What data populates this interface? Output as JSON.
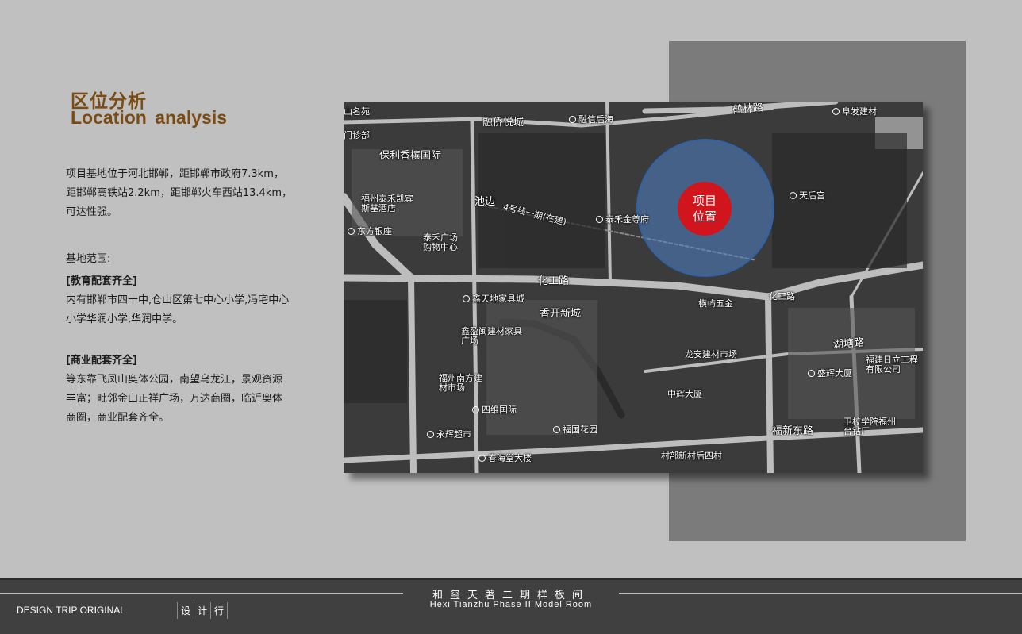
{
  "header": {
    "title_cn": "区位分析",
    "title_en": "Location  analysis"
  },
  "body": {
    "intro": "项目基地位于河北邯郸，距邯郸市政府7.3km，距邯郸高铁站2.2km，距邯郸火车西站13.4km，可达性强。",
    "scope_label": "基地范围:",
    "education_heading": "[教育配套齐全]",
    "education_text": "内有邯郸市四十中,仓山区第七中心小学,冯宅中心小学华润小学,华润中学。",
    "commerce_heading": "[商业配套齐全]",
    "commerce_text": "等东靠飞凤山奥体公园，南望乌龙江，景观资源丰富；毗邻金山正祥广场，万达商圈，临近奥体商圈，商业配套齐全。"
  },
  "map": {
    "site_marker": {
      "line1": "项目",
      "line2": "位置"
    },
    "colors": {
      "site_circle": "#5082c8",
      "site_marker": "#d0161c"
    },
    "labels": [
      "山名苑",
      "融侨悦城",
      "融信后海",
      "鹤林路",
      "阜发建材",
      "门诊部",
      "保利香槟国际",
      "池边",
      "福州泰禾凯宾斯基酒店",
      "4号线一期(在建)",
      "泰禾金尊府",
      "天后宫",
      "东方银座",
      "泰禾广场购物中心",
      "化工路",
      "化工路",
      "香开新城",
      "鑫天地家具城",
      "鑫盈闽建材家具广场",
      "横屿五金",
      "龙安建材市场",
      "湖塘路",
      "福建日立工程有限公司",
      "盛辉大厦",
      "中辉大厦",
      "福州南方建材市场",
      "四维国际",
      "福国花园",
      "永辉超市",
      "福新东路",
      "卫校学院福州台钻厂",
      "春海堂大楼",
      "村部新村后四村"
    ]
  },
  "footer": {
    "title_cn": "和玺天著二期样板间",
    "title_en": "Hexi Tianzhu Phase II Model Room",
    "brand": "DESIGN TRIP ORIGINAL",
    "chars": [
      "设",
      "计",
      "行"
    ]
  }
}
